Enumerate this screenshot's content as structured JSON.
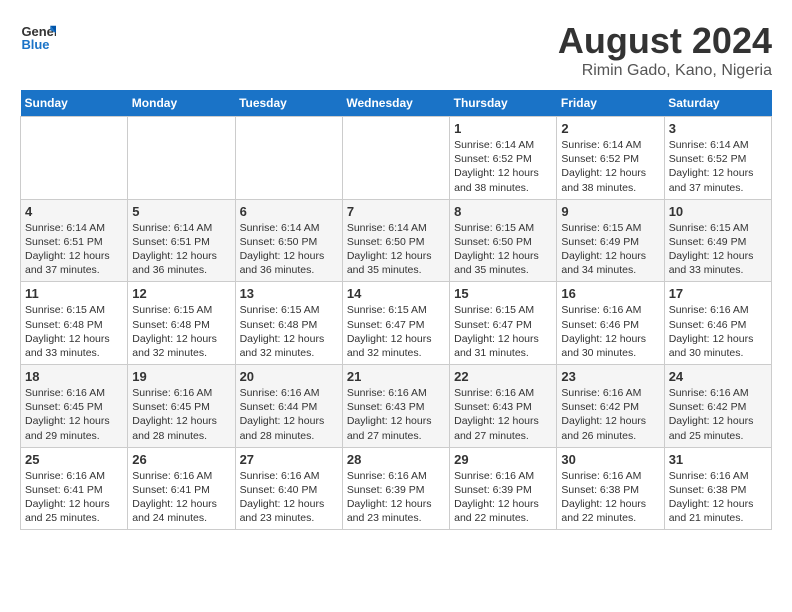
{
  "app": {
    "name": "GeneralBlue",
    "logo_text_line1": "General",
    "logo_text_line2": "Blue"
  },
  "calendar": {
    "month": "August 2024",
    "location": "Rimin Gado, Kano, Nigeria",
    "days_of_week": [
      "Sunday",
      "Monday",
      "Tuesday",
      "Wednesday",
      "Thursday",
      "Friday",
      "Saturday"
    ],
    "weeks": [
      [
        {
          "day": "",
          "info": ""
        },
        {
          "day": "",
          "info": ""
        },
        {
          "day": "",
          "info": ""
        },
        {
          "day": "",
          "info": ""
        },
        {
          "day": "1",
          "info": "Sunrise: 6:14 AM\nSunset: 6:52 PM\nDaylight: 12 hours\nand 38 minutes."
        },
        {
          "day": "2",
          "info": "Sunrise: 6:14 AM\nSunset: 6:52 PM\nDaylight: 12 hours\nand 38 minutes."
        },
        {
          "day": "3",
          "info": "Sunrise: 6:14 AM\nSunset: 6:52 PM\nDaylight: 12 hours\nand 37 minutes."
        }
      ],
      [
        {
          "day": "4",
          "info": "Sunrise: 6:14 AM\nSunset: 6:51 PM\nDaylight: 12 hours\nand 37 minutes."
        },
        {
          "day": "5",
          "info": "Sunrise: 6:14 AM\nSunset: 6:51 PM\nDaylight: 12 hours\nand 36 minutes."
        },
        {
          "day": "6",
          "info": "Sunrise: 6:14 AM\nSunset: 6:50 PM\nDaylight: 12 hours\nand 36 minutes."
        },
        {
          "day": "7",
          "info": "Sunrise: 6:14 AM\nSunset: 6:50 PM\nDaylight: 12 hours\nand 35 minutes."
        },
        {
          "day": "8",
          "info": "Sunrise: 6:15 AM\nSunset: 6:50 PM\nDaylight: 12 hours\nand 35 minutes."
        },
        {
          "day": "9",
          "info": "Sunrise: 6:15 AM\nSunset: 6:49 PM\nDaylight: 12 hours\nand 34 minutes."
        },
        {
          "day": "10",
          "info": "Sunrise: 6:15 AM\nSunset: 6:49 PM\nDaylight: 12 hours\nand 33 minutes."
        }
      ],
      [
        {
          "day": "11",
          "info": "Sunrise: 6:15 AM\nSunset: 6:48 PM\nDaylight: 12 hours\nand 33 minutes."
        },
        {
          "day": "12",
          "info": "Sunrise: 6:15 AM\nSunset: 6:48 PM\nDaylight: 12 hours\nand 32 minutes."
        },
        {
          "day": "13",
          "info": "Sunrise: 6:15 AM\nSunset: 6:48 PM\nDaylight: 12 hours\nand 32 minutes."
        },
        {
          "day": "14",
          "info": "Sunrise: 6:15 AM\nSunset: 6:47 PM\nDaylight: 12 hours\nand 32 minutes."
        },
        {
          "day": "15",
          "info": "Sunrise: 6:15 AM\nSunset: 6:47 PM\nDaylight: 12 hours\nand 31 minutes."
        },
        {
          "day": "16",
          "info": "Sunrise: 6:16 AM\nSunset: 6:46 PM\nDaylight: 12 hours\nand 30 minutes."
        },
        {
          "day": "17",
          "info": "Sunrise: 6:16 AM\nSunset: 6:46 PM\nDaylight: 12 hours\nand 30 minutes."
        }
      ],
      [
        {
          "day": "18",
          "info": "Sunrise: 6:16 AM\nSunset: 6:45 PM\nDaylight: 12 hours\nand 29 minutes."
        },
        {
          "day": "19",
          "info": "Sunrise: 6:16 AM\nSunset: 6:45 PM\nDaylight: 12 hours\nand 28 minutes."
        },
        {
          "day": "20",
          "info": "Sunrise: 6:16 AM\nSunset: 6:44 PM\nDaylight: 12 hours\nand 28 minutes."
        },
        {
          "day": "21",
          "info": "Sunrise: 6:16 AM\nSunset: 6:43 PM\nDaylight: 12 hours\nand 27 minutes."
        },
        {
          "day": "22",
          "info": "Sunrise: 6:16 AM\nSunset: 6:43 PM\nDaylight: 12 hours\nand 27 minutes."
        },
        {
          "day": "23",
          "info": "Sunrise: 6:16 AM\nSunset: 6:42 PM\nDaylight: 12 hours\nand 26 minutes."
        },
        {
          "day": "24",
          "info": "Sunrise: 6:16 AM\nSunset: 6:42 PM\nDaylight: 12 hours\nand 25 minutes."
        }
      ],
      [
        {
          "day": "25",
          "info": "Sunrise: 6:16 AM\nSunset: 6:41 PM\nDaylight: 12 hours\nand 25 minutes."
        },
        {
          "day": "26",
          "info": "Sunrise: 6:16 AM\nSunset: 6:41 PM\nDaylight: 12 hours\nand 24 minutes."
        },
        {
          "day": "27",
          "info": "Sunrise: 6:16 AM\nSunset: 6:40 PM\nDaylight: 12 hours\nand 23 minutes."
        },
        {
          "day": "28",
          "info": "Sunrise: 6:16 AM\nSunset: 6:39 PM\nDaylight: 12 hours\nand 23 minutes."
        },
        {
          "day": "29",
          "info": "Sunrise: 6:16 AM\nSunset: 6:39 PM\nDaylight: 12 hours\nand 22 minutes."
        },
        {
          "day": "30",
          "info": "Sunrise: 6:16 AM\nSunset: 6:38 PM\nDaylight: 12 hours\nand 22 minutes."
        },
        {
          "day": "31",
          "info": "Sunrise: 6:16 AM\nSunset: 6:38 PM\nDaylight: 12 hours\nand 21 minutes."
        }
      ]
    ]
  }
}
